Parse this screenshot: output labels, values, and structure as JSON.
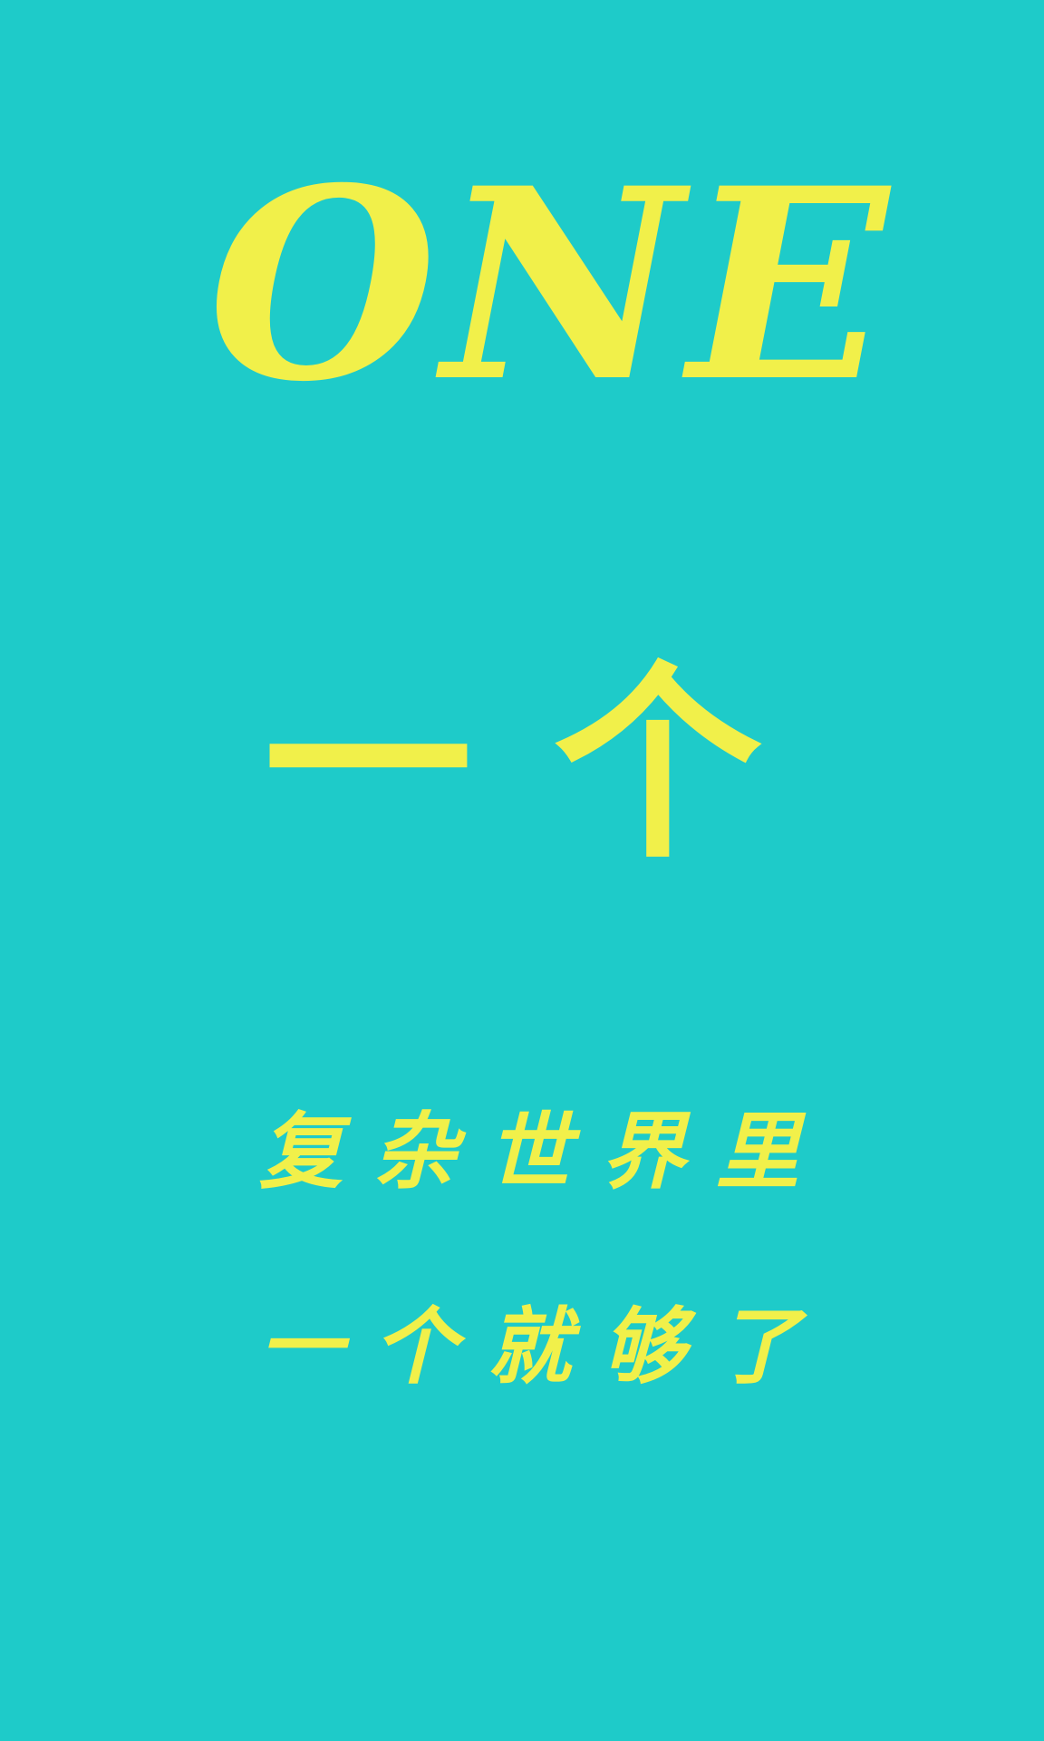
{
  "splash": {
    "title": "ONE",
    "subtitle": "一个",
    "slogan_lines": [
      "复杂世界里",
      "一个就够了"
    ],
    "colors": {
      "background": "#1ECBC9",
      "text": "#F1F04A"
    }
  }
}
